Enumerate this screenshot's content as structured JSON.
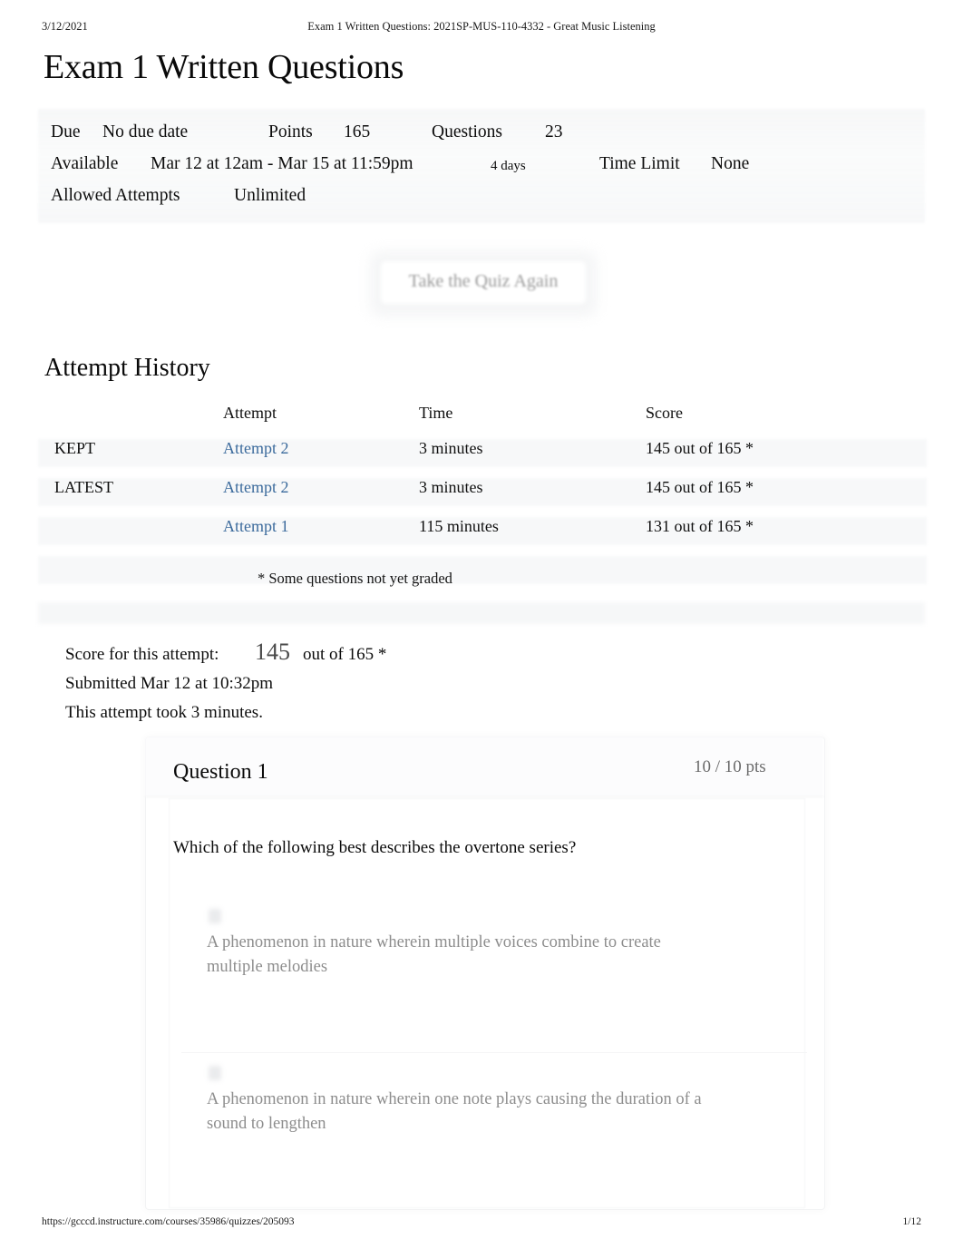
{
  "print": {
    "date": "3/12/2021",
    "header_title": "Exam 1 Written Questions: 2021SP-MUS-110-4332 - Great Music Listening",
    "footer_url": "https://gcccd.instructure.com/courses/35986/quizzes/205093",
    "footer_page": "1/12"
  },
  "page": {
    "title": "Exam 1 Written Questions"
  },
  "meta": {
    "due_label": "Due",
    "due_value": "No due date",
    "points_label": "Points",
    "points_value": "165",
    "questions_label": "Questions",
    "questions_value": "23",
    "available_label": "Available",
    "available_value": "Mar 12 at 12am - Mar 15 at 11:59pm",
    "available_duration": "4 days",
    "time_limit_label": "Time Limit",
    "time_limit_value": "None",
    "allowed_attempts_label": "Allowed Attempts",
    "allowed_attempts_value": "Unlimited"
  },
  "retake": {
    "label": "Take the Quiz Again"
  },
  "attempt_history": {
    "title": "Attempt History",
    "columns": {
      "kept": "",
      "attempt": "Attempt",
      "time": "Time",
      "score": "Score"
    },
    "rows": [
      {
        "kept": "KEPT",
        "attempt": "Attempt 2",
        "time": "3 minutes",
        "score": "145 out of 165 *"
      },
      {
        "kept": "LATEST",
        "attempt": "Attempt 2",
        "time": "3 minutes",
        "score": "145 out of 165 *"
      },
      {
        "kept": "",
        "attempt": "Attempt 1",
        "time": "115 minutes",
        "score": "131 out of 165 *"
      }
    ],
    "note": "* Some questions not yet graded"
  },
  "score_block": {
    "label": "Score for this attempt:",
    "value": "145",
    "out_of": "out of 165 *",
    "submitted": "Submitted Mar 12 at 10:32pm",
    "duration": "This attempt took 3 minutes."
  },
  "question": {
    "title": "Question 1",
    "points": "10 / 10 pts",
    "prompt": "Which of the following best describes the overtone series?",
    "answers": [
      {
        "text": "A phenomenon in nature wherein multiple voices combine to create multiple melodies"
      },
      {
        "text": "A phenomenon in nature wherein one note plays causing the duration of a sound to lengthen"
      }
    ]
  },
  "colors": {
    "link": "#3b6a9c",
    "text": "#0f0f0f",
    "muted": "#8d8d8d",
    "band": "#f7f8f9"
  }
}
